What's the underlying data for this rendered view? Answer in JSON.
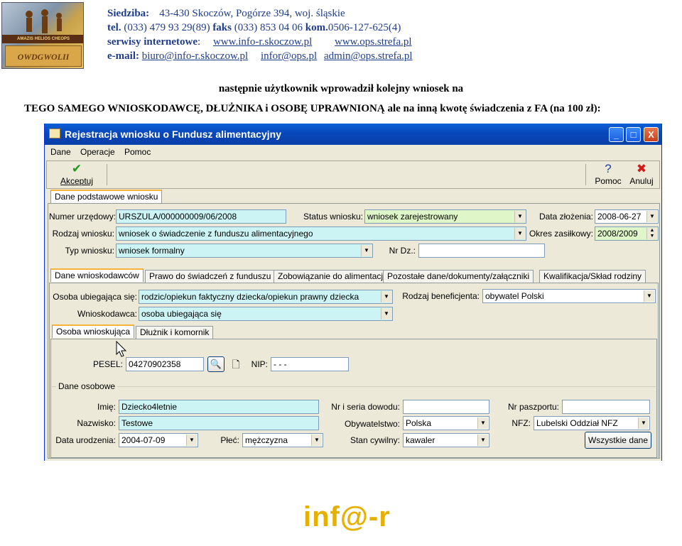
{
  "header": {
    "logo_text": "AMAZIS HELIOS CHEOPS",
    "logo_bottom_text": "OWDGWOLII",
    "seat_label": "Siedziba:",
    "seat_value": "43-430 Skoczów,  Pogórze 394,  woj. śląskie",
    "tel_label": "tel.",
    "tel_value": "(033) 479 93 29(89)",
    "fax_label": "faks",
    "fax_value": "(033) 853 04 06",
    "mob_label": "kom.",
    "mob_value": "0506-127-625(4)",
    "services_label": "serwisy internetowe",
    "services_colon": ":",
    "site1": "www.info-r.skoczow.pl",
    "site2": "www.ops.strefa.pl",
    "email_label": "e-mail:",
    "email1": "biuro@info-r.skoczow.pl",
    "email2": "infor@ops.pl",
    "email3": "admin@ops.strefa.pl"
  },
  "caption1": "następnie użytkownik wprowadził kolejny wniosek na",
  "caption2": "TEGO SAMEGO WNIOSKODAWCĘ, DŁUŻNIKA i OSOBĘ UPRAWNIONĄ ale na inną kwotę świadczenia z FA (na 100 zł):",
  "window": {
    "title": "Rejestracja wniosku o Fundusz alimentacyjny",
    "btn_min": "_",
    "btn_max": "□",
    "btn_close": "X",
    "menu": [
      "Dane",
      "Operacje",
      "Pomoc"
    ],
    "toolbar": {
      "accept": "Akceptuj",
      "help": "Pomoc",
      "cancel": "Anuluj"
    },
    "main_tab": "Dane podstawowe wniosku",
    "basic": {
      "num_label": "Numer urzędowy:",
      "num_value": "URSZULA/000000009/06/2008",
      "status_label": "Status wniosku:",
      "status_value": "wniosek zarejestrowany",
      "date_label": "Data złożenia:",
      "date_value": "2008-06-27",
      "kind_label": "Rodzaj wniosku:",
      "kind_value": "wniosek o świadczenie z funduszu alimentacyjnego",
      "period_label": "Okres zasiłkowy:",
      "period_value": "2008/2009",
      "type_label": "Typ wniosku:",
      "type_value": "wniosek formalny",
      "nrdz_label": "Nr Dz.:",
      "nrdz_value": ""
    },
    "tabs": [
      "Dane wnioskodawców",
      "Prawo do świadczeń z funduszu",
      "Zobowiązanie do alimentacji",
      "Pozostałe dane/dokumenty/załączniki",
      "Kwalifikacja/Skład rodziny"
    ],
    "applicant": {
      "person_label": "Osoba ubiegająca się:",
      "person_value": "rodzic/opiekun faktyczny dziecka/opiekun prawny dziecka",
      "benef_label": "Rodzaj beneficjenta:",
      "benef_value": "obywatel Polski",
      "appl_label": "Wnioskodawca:",
      "appl_value": "osoba ubiegająca się"
    },
    "subtabs": [
      "Osoba wnioskująca",
      "Dłużnik i komornik"
    ],
    "person": {
      "pesel_label": "PESEL:",
      "pesel_value": "04270902358",
      "nip_label": "NIP:",
      "nip_value": " -  -  - ",
      "group_label": "Dane osobowe",
      "name_label": "Imię:",
      "name_value": "Dziecko4letnie",
      "idcard_label": "Nr i seria dowodu:",
      "idcard_value": "",
      "passport_label": "Nr paszportu:",
      "passport_value": "",
      "surname_label": "Nazwisko:",
      "surname_value": "Testowe",
      "citizenship_label": "Obywatelstwo:",
      "citizenship_value": "Polska",
      "nfz_label": "NFZ:",
      "nfz_value": "Lubelski Oddział NFZ",
      "birth_label": "Data urodzenia:",
      "birth_value": "2004-07-09",
      "sex_label": "Płeć:",
      "sex_value": "mężczyzna",
      "civil_label": "Stan cywilny:",
      "civil_value": "kawaler",
      "all_data_btn": "Wszystkie dane"
    }
  },
  "footer": {
    "logo": "inf@-r"
  },
  "colors": {
    "titlebar": "#0846b8",
    "header_text": "#1f3d8a",
    "cyan_field": "#ccf4f4",
    "logo": "#e5b000"
  }
}
